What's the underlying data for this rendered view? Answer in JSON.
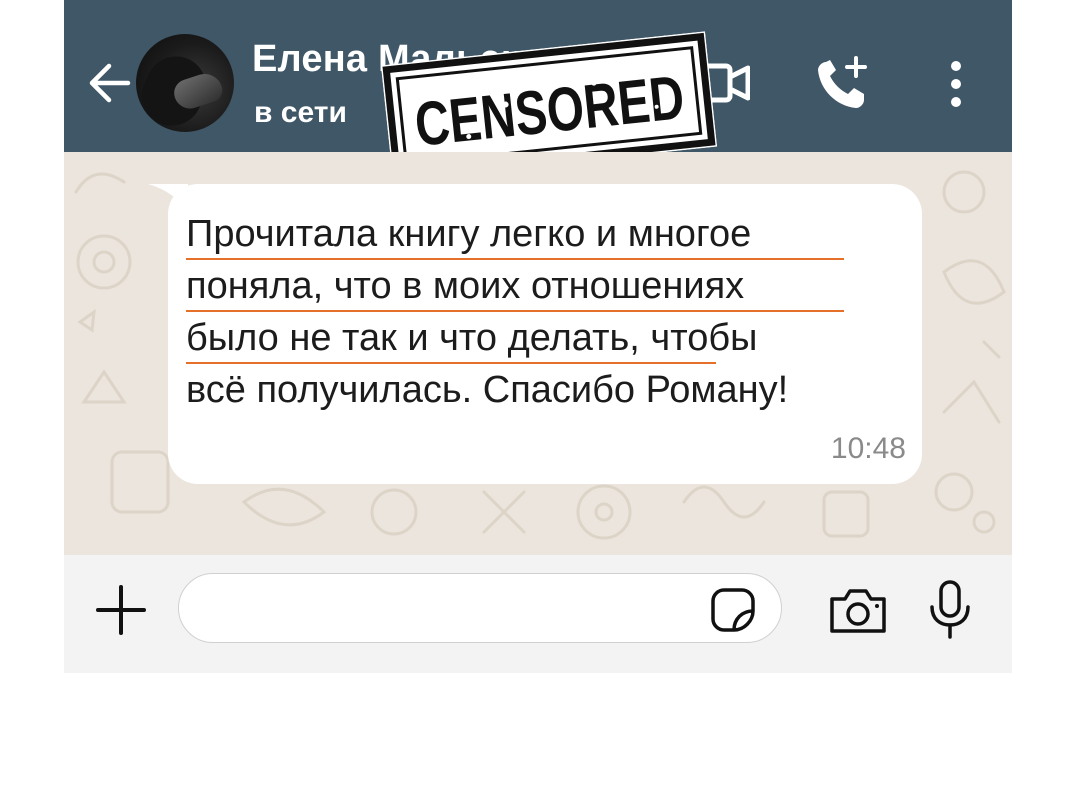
{
  "header": {
    "contact_name": "Елена Мальская",
    "status": "в сети",
    "stamp_text": "CENSORED"
  },
  "message": {
    "lines": [
      "Прочитала книгу легко и многое",
      "поняла, что в моих отношениях",
      "было не так и что делать, чтобы",
      "всё получилась. Спасибо Роману!"
    ],
    "time": "10:48"
  },
  "input": {
    "placeholder": ""
  },
  "colors": {
    "header_bg": "#3f5767",
    "chat_bg": "#ece5dd",
    "bubble_bg": "#ffffff",
    "underline": "#e5702a",
    "inputbar_bg": "#f3f3f3"
  },
  "icons": [
    "back-arrow-icon",
    "video-call-icon",
    "add-call-icon",
    "more-options-icon",
    "plus-icon",
    "sticker-icon",
    "camera-icon",
    "microphone-icon"
  ]
}
